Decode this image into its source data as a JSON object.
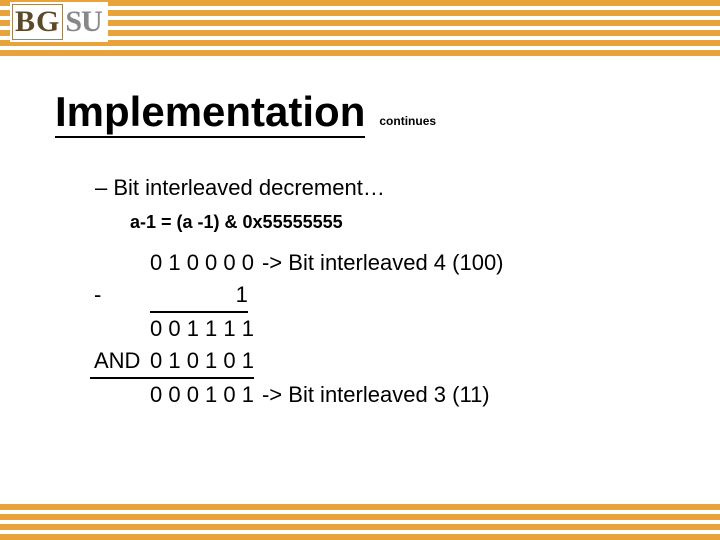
{
  "logo": {
    "bg": "BG",
    "su": "SU"
  },
  "title": "Implementation",
  "continues": "continues",
  "subtitle": "– Bit interleaved decrement…",
  "formula": "a-1 = (a -1) & 0x55555555",
  "calc": {
    "row1_bits": "0 1 0 0 0 0",
    "row1_note": " -> Bit interleaved 4 (100)",
    "row2_op": "-",
    "row2_bits": "              1",
    "row3_bits": "0 0 1 1 1 1",
    "row4_op": "AND",
    "row4_bits": "0 1 0 1 0 1",
    "row5_bits": "0 0 0 1 0 1",
    "row5_note": " -> Bit interleaved 3 (11)"
  }
}
